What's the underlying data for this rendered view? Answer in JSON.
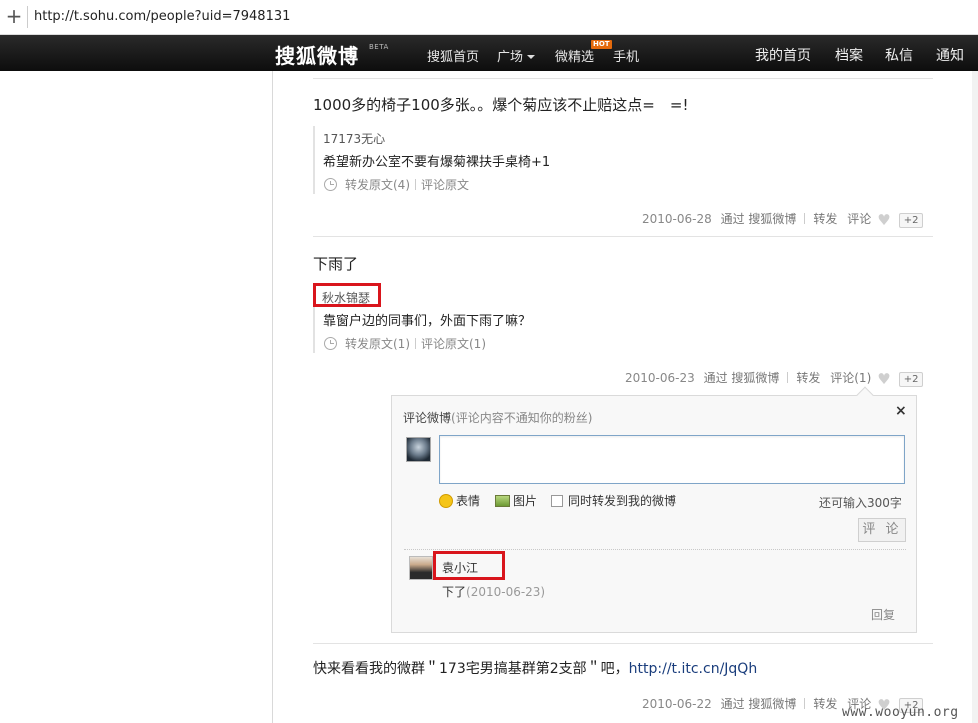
{
  "browser": {
    "url": "http://t.sohu.com/people?uid=7948131",
    "new_tab": "+"
  },
  "nav": {
    "logo": "搜狐微博",
    "beta": "BETA",
    "home": "搜狐首页",
    "square": "广场",
    "picks": "微精选",
    "hot": "HOT",
    "mobile": "手机",
    "my_home": "我的首页",
    "profile": "档案",
    "messages": "私信",
    "notify": "通知"
  },
  "posts": [
    {
      "text": "1000多的椅子100多张。。爆个菊应该不止赔这点=　=!",
      "quote_author": "17173无心",
      "quote_text": "希望新办公室不要有爆菊裸扶手桌椅+1",
      "quote_forward": "转发原文(4)",
      "quote_comment": "评论原文",
      "date": "2010-06-28",
      "via": "通过 搜狐微博",
      "forward": "转发",
      "comment": "评论",
      "plus": "+2"
    },
    {
      "text": "下雨了",
      "quote_author": "秋水锦瑟",
      "quote_text": "靠窗户边的同事们，外面下雨了嘛？",
      "quote_forward": "转发原文(1)",
      "quote_comment": "评论原文(1)",
      "date": "2010-06-23",
      "via": "通过 搜狐微博",
      "forward": "转发",
      "comment": "评论(1)",
      "plus": "+2"
    },
    {
      "text_prefix": "快来看看我的微群＂173宅男搞基群第2支部＂吧，",
      "link": "http://t.itc.cn/JqQh",
      "date": "2010-06-22",
      "via": "通过 搜狐微博",
      "forward": "转发",
      "comment": "评论",
      "plus": "+2"
    }
  ],
  "comment_box": {
    "title": "评论微博",
    "subtitle": "(评论内容不通知你的粉丝)",
    "close": "×",
    "textarea_value": "",
    "emoji": "表情",
    "image": "图片",
    "also_forward": "同时转发到我的微博",
    "remaining": "还可输入300字",
    "submit": "评 论",
    "comments": [
      {
        "author": "袁小江",
        "text": "下了",
        "date": "(2010-06-23)",
        "reply": "回复"
      }
    ]
  },
  "watermark": "www.wooyun.org",
  "colors": {
    "highlight_box": "#d9151c",
    "nav_bg": "#111111",
    "link": "#1a3d7c"
  }
}
